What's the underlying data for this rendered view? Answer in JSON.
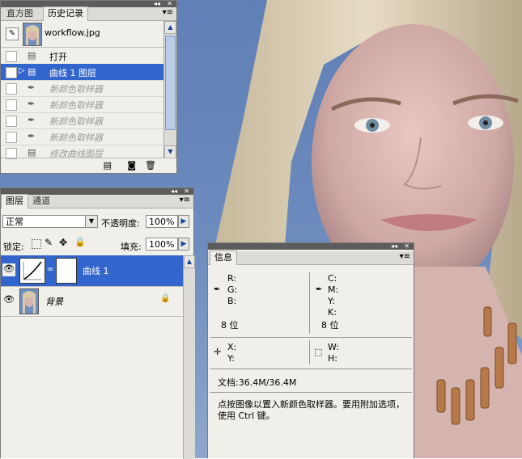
{
  "history_panel": {
    "tabs": [
      "直方图",
      "历史记录"
    ],
    "snapshot_name": "workflow.jpg",
    "items": [
      {
        "label": "打开",
        "state": "normal"
      },
      {
        "label": "曲线 1 图层",
        "state": "selected"
      },
      {
        "label": "新颜色取样器",
        "state": "dimmed"
      },
      {
        "label": "新颜色取样器",
        "state": "dimmed"
      },
      {
        "label": "新颜色取样器",
        "state": "dimmed"
      },
      {
        "label": "新颜色取样器",
        "state": "dimmed"
      },
      {
        "label": "修改曲线图层",
        "state": "dimmed"
      }
    ]
  },
  "layers_panel": {
    "tabs": [
      "图层",
      "通道"
    ],
    "blend_mode": "正常",
    "opacity_label": "不透明度:",
    "opacity_value": "100%",
    "lock_label": "锁定:",
    "fill_label": "填充:",
    "fill_value": "100%",
    "layers": [
      {
        "name": "曲线 1",
        "selected": true
      },
      {
        "name": "背景",
        "selected": false,
        "locked": true
      }
    ]
  },
  "info_panel": {
    "tab": "信息",
    "rgb_labels": [
      "R:",
      "G:",
      "B:"
    ],
    "cmyk_labels": [
      "C:",
      "M:",
      "Y:",
      "K:"
    ],
    "bit_left": "8 位",
    "bit_right": "8 位",
    "xy_labels": [
      "X:",
      "Y:"
    ],
    "wh_labels": [
      "W:",
      "H:"
    ],
    "doc_size": "文档:36.4M/36.4M",
    "hint": "点按图像以置入新颜色取样器。要用附加选项，使用 Ctrl 键。"
  },
  "colors": {
    "selection": "#3366cc",
    "panel_bg": "#f0efe9",
    "titlebar": "#5c5c5c"
  }
}
